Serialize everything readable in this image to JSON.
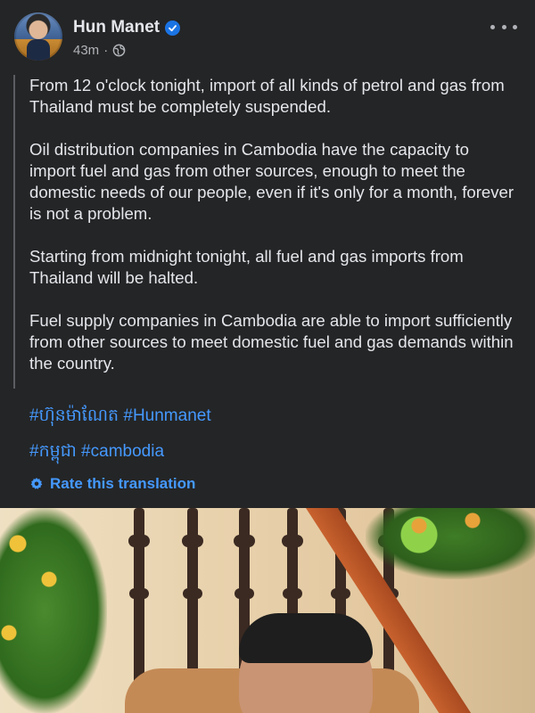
{
  "post": {
    "author": "Hun Manet",
    "time": "43m",
    "separator": "·",
    "paragraphs": [
      "From 12 o'clock tonight, import of all kinds of petrol and gas from Thailand must be completely suspended.",
      "Oil distribution companies in Cambodia have the capacity to import fuel and gas from other sources, enough to meet the domestic needs of our people, even if it's only for a month, forever is not a problem.",
      "Starting from midnight tonight, all fuel and gas imports from Thailand will be halted.",
      "Fuel supply companies in Cambodia are able to import sufficiently from other sources to meet domestic fuel and gas demands within the country."
    ],
    "hashtags_line1": "#ហ៊ុនម៉ាណែត #Hunmanet",
    "hashtags_line2": "#កម្ពុជា #cambodia",
    "rate_translation": "Rate this translation"
  },
  "colors": {
    "background": "#242526",
    "text": "#e4e6eb",
    "secondary_text": "#b0b3b8",
    "link": "#4599ff",
    "verified": "#1b74e4"
  },
  "icons": {
    "verified": "verified-badge-icon",
    "audience": "globe-icon",
    "more": "more-options-icon",
    "rate": "gear-icon"
  }
}
